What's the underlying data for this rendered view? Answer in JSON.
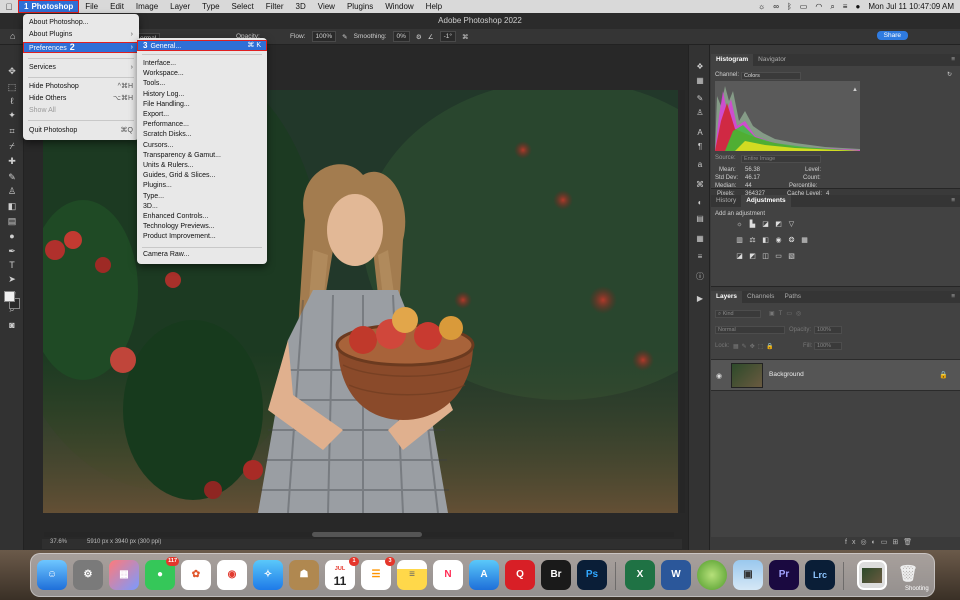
{
  "menubar": {
    "app": "Photoshop",
    "items": [
      "File",
      "Edit",
      "Image",
      "Layer",
      "Type",
      "Select",
      "Filter",
      "3D",
      "View",
      "Plugins",
      "Window",
      "Help"
    ],
    "clock": "Mon Jul 11  10:47:09 AM"
  },
  "window": {
    "title": "Adobe Photoshop 2022"
  },
  "options": {
    "mode_value": "ormal",
    "opacity_label": "Opacity:",
    "opacity": "100%",
    "flow_label": "Flow:",
    "flow": "100%",
    "smoothing_label": "Smoothing:",
    "smoothing": "0%",
    "angle": "-1°",
    "share": "Share"
  },
  "annotations": {
    "step1": "1",
    "step2": "2",
    "step3": "3"
  },
  "app_menu": [
    {
      "label": "About Photoshop..."
    },
    {
      "label": "About Plugins",
      "arrow": "›"
    },
    {
      "label": "Preferences",
      "arrow": "›"
    },
    {
      "label": "Services",
      "arrow": "›"
    },
    {
      "label": "Hide Photoshop",
      "shortcut": "^⌘H"
    },
    {
      "label": "Hide Others",
      "shortcut": "⌥⌘H"
    },
    {
      "label": "Show All"
    },
    {
      "label": "Quit Photoshop",
      "shortcut": "⌘Q"
    }
  ],
  "prefs_menu": {
    "general": {
      "label": "General...",
      "shortcut": "⌘ K"
    },
    "items": [
      "Interface...",
      "Workspace...",
      "Tools...",
      "History Log...",
      "File Handling...",
      "Export...",
      "Performance...",
      "Scratch Disks...",
      "Cursors...",
      "Transparency & Gamut...",
      "Units & Rulers...",
      "Guides, Grid & Slices...",
      "Plugins...",
      "Type...",
      "3D...",
      "Enhanced Controls...",
      "Technology Previews...",
      "Product Improvement..."
    ],
    "camera_raw": "Camera Raw..."
  },
  "status": {
    "zoom": "37.6%",
    "doc": "5910 px x 3940 px (300 ppi)"
  },
  "histogram": {
    "tabs": [
      "Histogram",
      "Navigator"
    ],
    "channel_label": "Channel:",
    "channel": "Colors",
    "source_label": "Source:",
    "source": "Entire Image",
    "mean_label": "Mean:",
    "mean": "56.38",
    "stddev_label": "Std Dev:",
    "stddev": "46.17",
    "median_label": "Median:",
    "median": "44",
    "pixels_label": "Pixels:",
    "pixels": "364327",
    "level_label": "Level:",
    "count_label": "Count:",
    "percentile_label": "Percentile:",
    "cache_label": "Cache Level:",
    "cache": "4"
  },
  "adjustments": {
    "tabs": [
      "History",
      "Adjustments"
    ],
    "hint": "Add an adjustment"
  },
  "layers": {
    "tabs": [
      "Layers",
      "Channels",
      "Paths"
    ],
    "kind": "Kind",
    "blend": "Normal",
    "opacity_label": "Opacity:",
    "opacity": "100%",
    "lock_label": "Lock:",
    "fill_label": "Fill:",
    "fill": "100%",
    "layer_name": "Background"
  },
  "dock": {
    "messages_badge": "117",
    "calendar_month": "JUL",
    "calendar_day": "11",
    "calendar_badge": "1",
    "reminders_badge": "3",
    "labels": {
      "br": "Br",
      "ps": "Ps",
      "pr": "Pr",
      "lrc": "Lrc",
      "q": "Q"
    },
    "caption": "Shooting"
  }
}
